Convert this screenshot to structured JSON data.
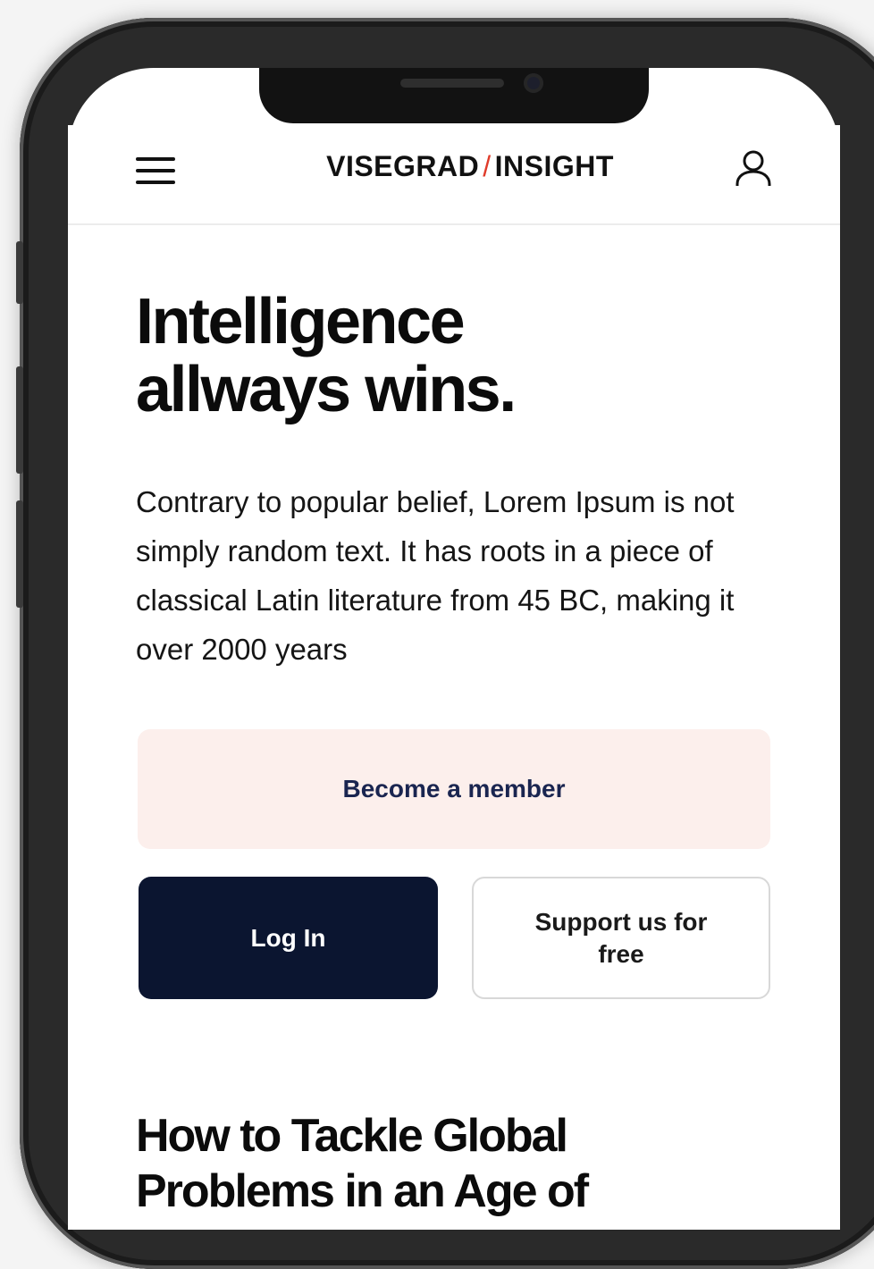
{
  "header": {
    "logo_left": "VISEGRAD",
    "logo_separator": "/",
    "logo_right": "INSIGHT",
    "menu_icon": "hamburger-menu-icon",
    "user_icon": "user-account-icon"
  },
  "hero": {
    "headline_line1": "Intelligence",
    "headline_line2": "allways wins.",
    "body": "Contrary to popular belief, Lorem Ipsum is not simply random text. It has roots in a piece of classical Latin literature from 45 BC, making it over 2000 years"
  },
  "actions": {
    "member_label": "Become a member",
    "login_label": "Log In",
    "support_label": "Support us for free"
  },
  "article": {
    "title": "How to Tackle Global Problems in an Age of"
  },
  "colors": {
    "accent_slash": "#e03b2a",
    "member_bg": "#fcefec",
    "member_text": "#1a2550",
    "login_bg": "#0b1530"
  }
}
